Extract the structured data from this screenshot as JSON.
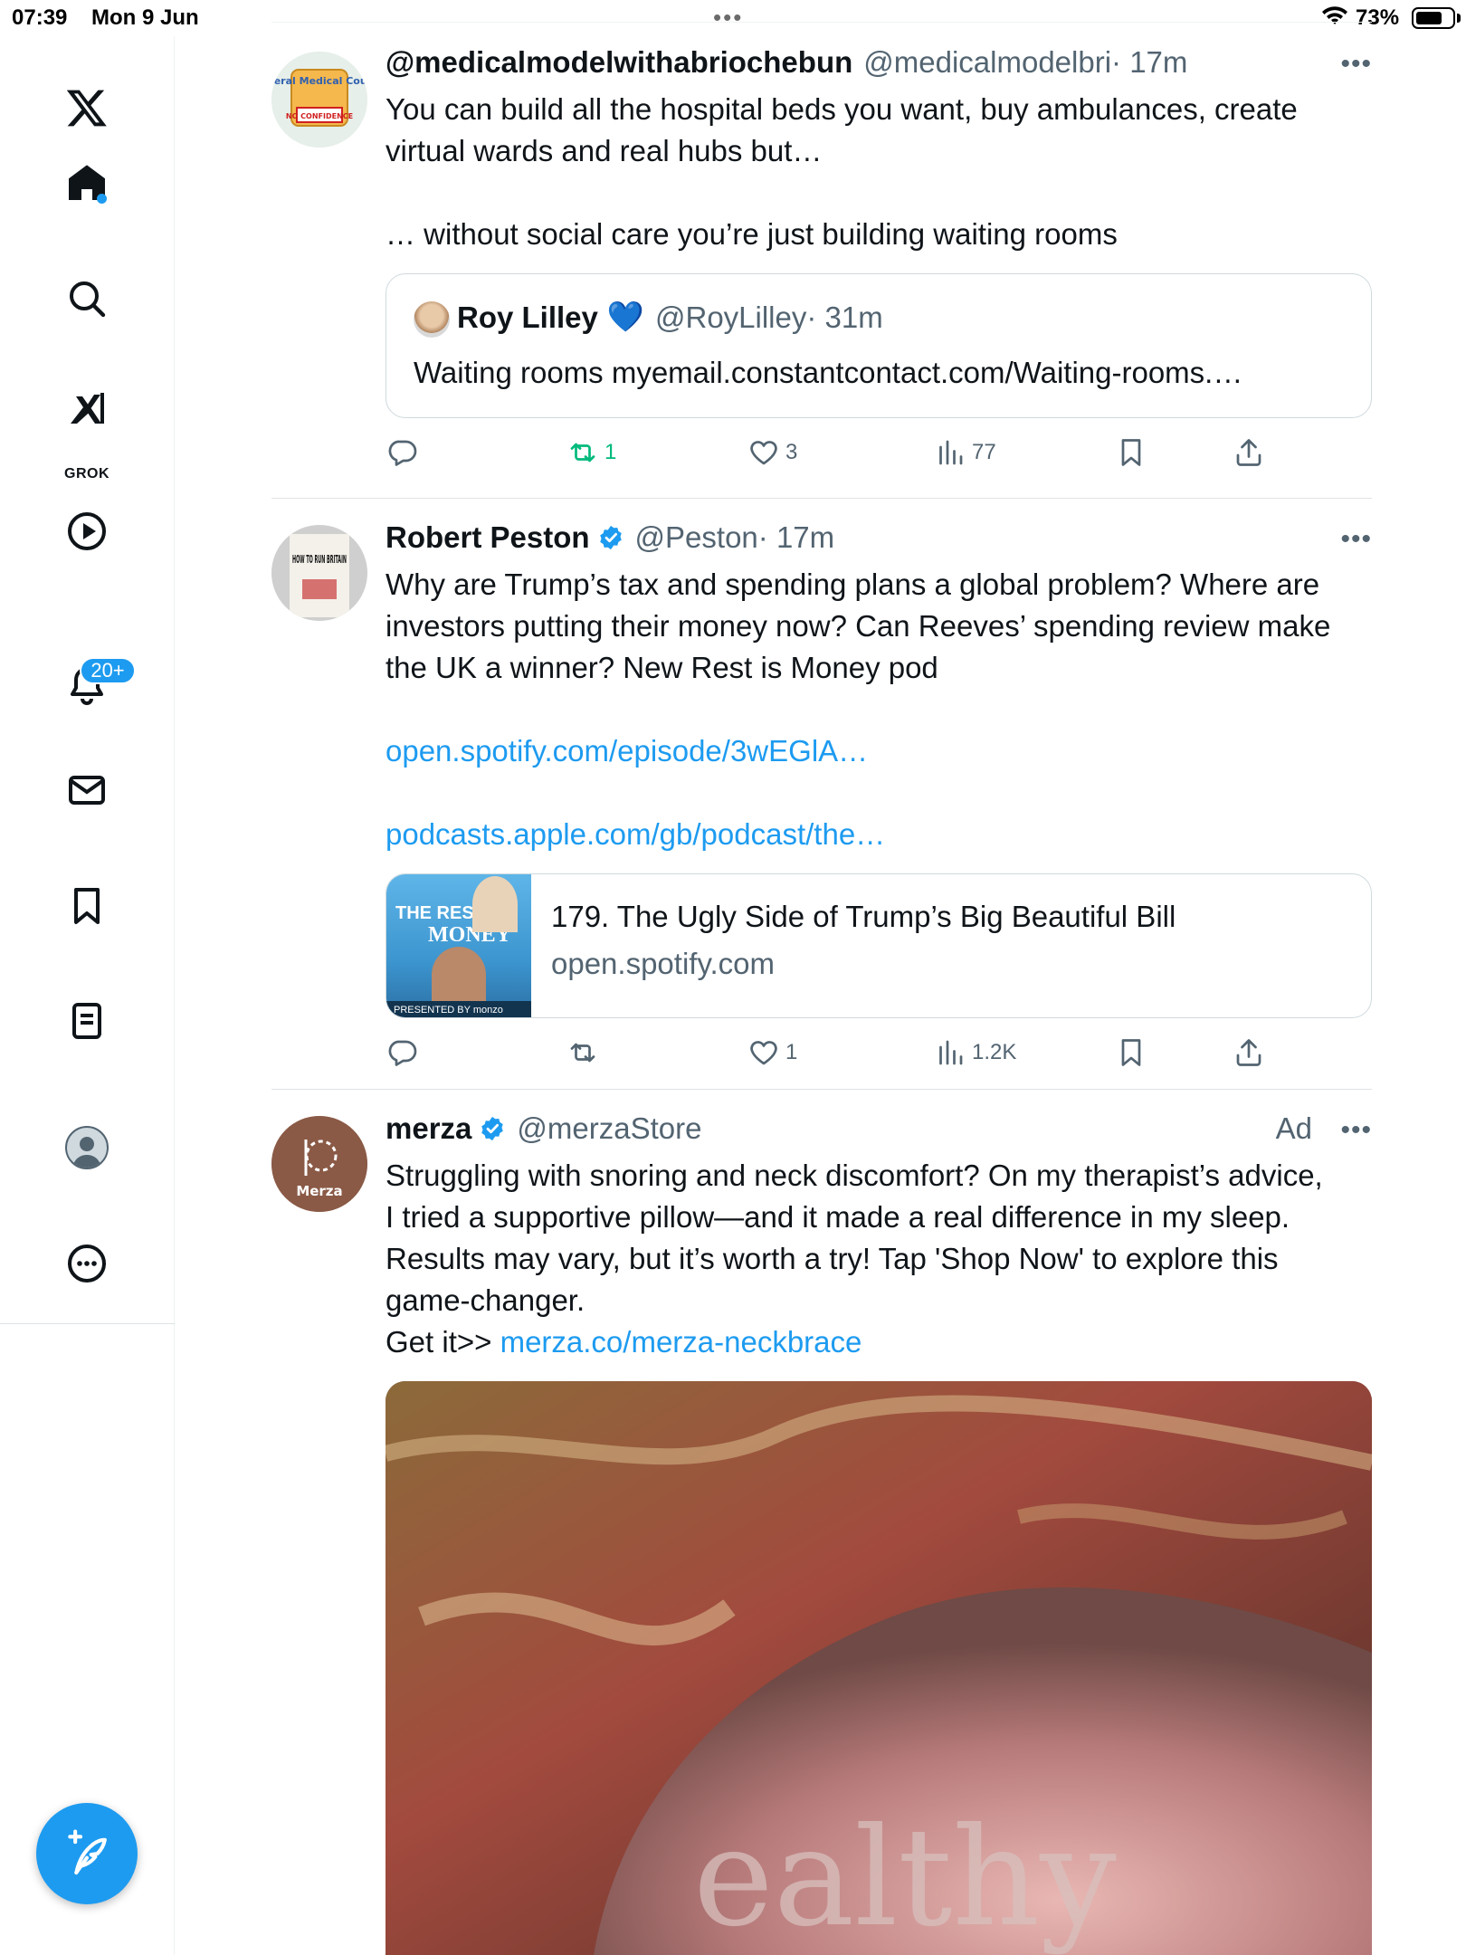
{
  "status_bar": {
    "time": "07:39",
    "date": "Mon 9 Jun",
    "battery_pct": "73%",
    "battery_level": 0.73
  },
  "sidebar": {
    "items": [
      {
        "icon": "x-logo-icon",
        "label": ""
      },
      {
        "icon": "home-icon",
        "label": ""
      },
      {
        "icon": "search-icon",
        "label": ""
      },
      {
        "icon": "grok-icon",
        "label": "GROK"
      },
      {
        "icon": "video-play-icon",
        "label": ""
      },
      {
        "icon": "bell-icon",
        "label": ""
      },
      {
        "icon": "mail-icon",
        "label": ""
      },
      {
        "icon": "bookmark-icon",
        "label": ""
      },
      {
        "icon": "list-icon",
        "label": ""
      },
      {
        "icon": "profile-icon",
        "label": ""
      },
      {
        "icon": "more-circle-icon",
        "label": ""
      }
    ],
    "notification_badge": "20+",
    "accent": "#1d9bf0"
  },
  "tweets": [
    {
      "name": "@medicalmodelwithabriochebun",
      "handle": "@medicalmodelbri",
      "time": "· 17m",
      "body_line1": "You can build all the hospital beds you want, buy ambulances, create",
      "body_line2": "virtual wards and real hubs but…",
      "body_line3": "… without social care you’re just building waiting rooms",
      "avatar_text": "General Medical Council",
      "avatar_stamp": "NO CONFIDENCE",
      "quote": {
        "name": "Roy Lilley",
        "emoji": "💙",
        "handle": "@RoyLilley",
        "time": "· 31m",
        "body": "Waiting rooms myemail.constantcontact.com/Waiting-rooms.…"
      },
      "actions": {
        "replies": "",
        "reposts": "1",
        "likes": "3",
        "views": "77"
      }
    },
    {
      "name": "Robert Peston",
      "handle": "@Peston",
      "time": "· 17m",
      "body_line1": "Why are Trump’s tax and spending plans a global problem? Where are",
      "body_line2": "investors putting their money now? Can Reeves’ spending review make",
      "body_line3": "the UK a winner? New Rest is Money pod",
      "link1": "open.spotify.com/episode/3wEGlA…",
      "link2": "podcasts.apple.com/gb/podcast/the…",
      "avatar_book": "HOW TO RUN BRITAIN",
      "card": {
        "title": "179. The Ugly Side of Trump’s Big Beautiful Bill",
        "domain": "open.spotify.com",
        "thumb_title1": "THE REST IS",
        "thumb_title2": "MONEY",
        "thumb_footer": "PRESENTED BY monzo"
      },
      "actions": {
        "replies": "",
        "reposts": "",
        "likes": "1",
        "views": "1.2K"
      }
    },
    {
      "name": "merza",
      "handle": "@merzaStore",
      "ad_label": "Ad",
      "avatar_label": "Merza",
      "body_line1": "Struggling with snoring and neck discomfort? On my therapist’s advice,",
      "body_line2": "I tried a supportive pillow—and it made a real difference in my sleep.",
      "body_line3": "Results may vary, but it’s worth a try! Tap 'Shop Now' to explore this",
      "body_line4": "game-changer.",
      "body_line5_prefix": "Get it>> ",
      "body_line5_link": "merza.co/merza-neckbrace",
      "media_watermark": "ealthy"
    }
  ]
}
